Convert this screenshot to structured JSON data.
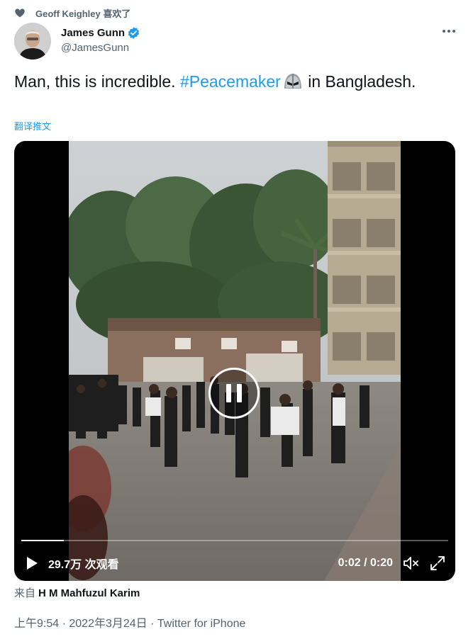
{
  "social_context": {
    "text": "Geoff Keighley 喜欢了"
  },
  "author": {
    "name": "James Gunn",
    "handle": "@JamesGunn"
  },
  "tweet": {
    "text_before": "Man, this is incredible. ",
    "hashtag": "#Peacemaker",
    "text_after": " in Bangladesh.",
    "translate_label": "翻译推文"
  },
  "video": {
    "views": "29.7万 次观看",
    "time": "0:02 / 0:20",
    "progress": 0.1
  },
  "source": {
    "prefix": "来自",
    "creator": "H M Mahfuzul Karim"
  },
  "meta": {
    "time": "上午9:54",
    "sep1": " · ",
    "date": "2022年3月24日",
    "sep2": " · ",
    "client": "Twitter for iPhone"
  },
  "colors": {
    "accent": "#1d9bf0",
    "secondary_text": "#536471",
    "primary_text": "#0f1419"
  },
  "icons": {
    "social": "heart-icon",
    "verified": "verified-badge-icon",
    "more": "more-icon",
    "emoji": "peacemaker-helmet-emoji",
    "pause": "pause-icon",
    "play": "play-icon",
    "mute": "mute-icon",
    "fullscreen": "fullscreen-icon"
  }
}
